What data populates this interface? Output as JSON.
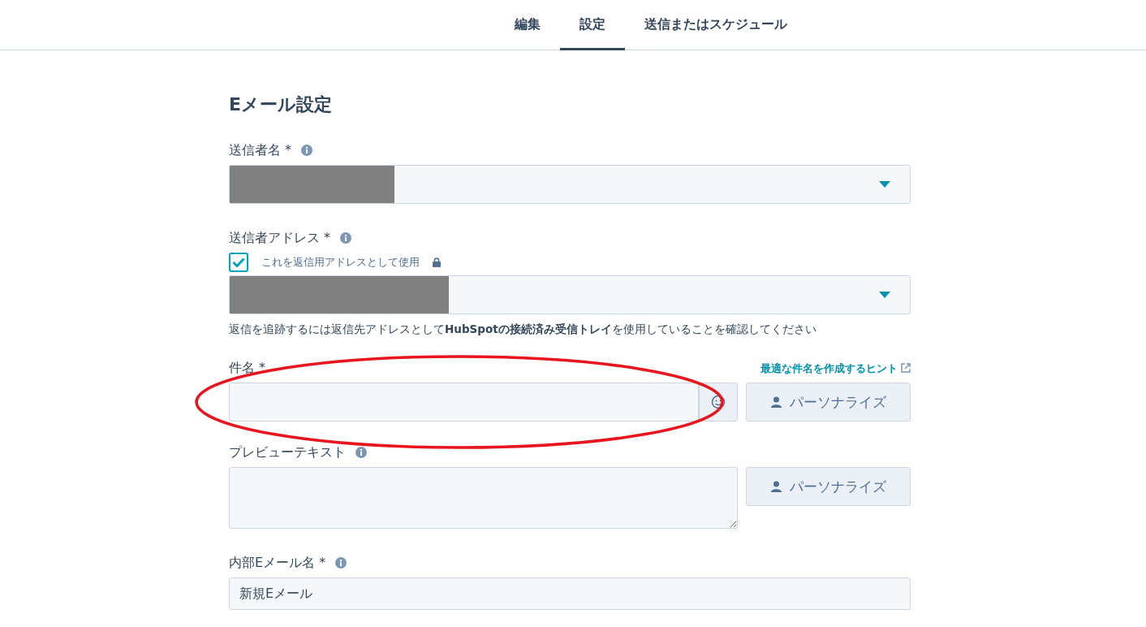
{
  "tabs": [
    {
      "label": "編集",
      "selected": false
    },
    {
      "label": "設定",
      "selected": true
    },
    {
      "label": "送信またはスケジュール",
      "selected": false
    }
  ],
  "heading": "Eメール設定",
  "sender_name": {
    "label": "送信者名 *",
    "info": true,
    "redacted": true
  },
  "sender_address": {
    "label": "送信者アドレス *",
    "info": true,
    "reply_checkbox": {
      "label": "これを返信用アドレスとして使用",
      "checked": true,
      "locked": true
    },
    "redacted": true,
    "help": "返信を追跡するには返信先アドレスとして**HubSpotの接続済み受信トレイ**を使用していることを確認してください"
  },
  "subject": {
    "label": "件名 *",
    "tip_link": "最適な件名を作成するヒント",
    "personalize": "パーソナライズ"
  },
  "preview_text": {
    "label": "プレビューテキスト",
    "info": true,
    "personalize": "パーソナライズ"
  },
  "internal_name": {
    "label": "内部Eメール名 *",
    "info": true,
    "value": "新規Eメール"
  },
  "annotation": {
    "kind": "ellipse",
    "color": "#e8141e"
  }
}
